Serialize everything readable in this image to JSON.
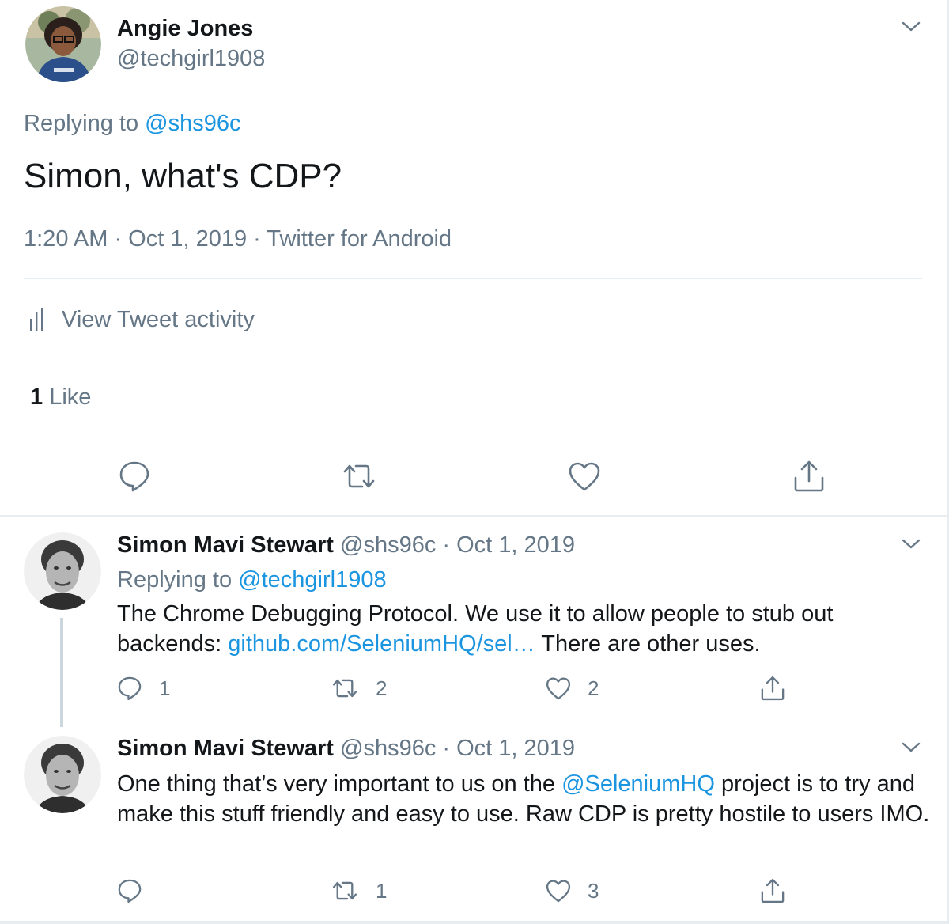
{
  "main_tweet": {
    "name": "Angie Jones",
    "handle": "@techgirl1908",
    "replying_prefix": "Replying to ",
    "replying_to": "@shs96c",
    "text": "Simon, what's CDP?",
    "meta": "1:20 AM · Oct 1, 2019 · Twitter for Android",
    "activity_label": "View Tweet activity",
    "like_count": "1",
    "like_label": " Like",
    "icons": [
      "reply-icon",
      "retweet-icon",
      "like-icon",
      "share-icon"
    ]
  },
  "replies": [
    {
      "name": "Simon Mavi Stewart",
      "handle_date": " @shs96c · Oct 1, 2019",
      "replying_prefix": "Replying to ",
      "replying_to": "@techgirl1908",
      "text_before": "The Chrome Debugging Protocol. We use it to allow people to stub out backends: ",
      "link": "github.com/SeleniumHQ/sel…",
      "text_after": " There are other uses.",
      "reply_count": "1",
      "retweet_count": "2",
      "like_count": "2"
    },
    {
      "name": "Simon Mavi Stewart",
      "handle_date": " @shs96c · Oct 1, 2019",
      "text_before": "One thing that’s very important to us on the ",
      "mention": "@SeleniumHQ",
      "text_after": " project is to try and make this stuff friendly and easy to use. Raw CDP is pretty hostile to users IMO.",
      "reply_count": "",
      "retweet_count": "1",
      "like_count": "3"
    }
  ],
  "colors": {
    "text": "#14171a",
    "secondary": "#657786",
    "link": "#1b95e0",
    "border": "#e6ecf0"
  }
}
